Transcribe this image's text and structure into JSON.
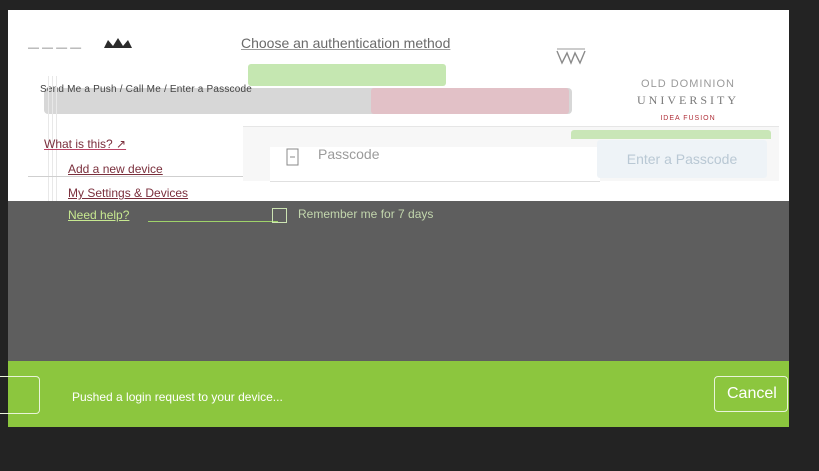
{
  "auth": {
    "method_title": "Choose an authentication method",
    "options_label": "Send Me a Push / Call Me / Enter a Passcode",
    "passcode_placeholder": "Passcode",
    "enter_passcode_button": "Enter a Passcode",
    "remember_me_label": "Remember me for 7 days"
  },
  "branding": {
    "university_top": "OLD DOMINION",
    "university_name": "UNIVERSITY",
    "tagline": "IDEA FUSION"
  },
  "links": {
    "what_is_this": "What is this? ↗",
    "add_device": "Add a new device",
    "settings": "My Settings & Devices",
    "help": "Need help?"
  },
  "status": {
    "message": "Pushed a login request to your device...",
    "cancel_label": "Cancel"
  },
  "colors": {
    "status_banner": "#8cc63e",
    "dim_overlay": "#5e5e5e",
    "brand_red": "#b0303a",
    "background": "#232323"
  },
  "icons": [
    "crown-icon",
    "crest-icon",
    "passcode-icon",
    "external-link-icon"
  ]
}
